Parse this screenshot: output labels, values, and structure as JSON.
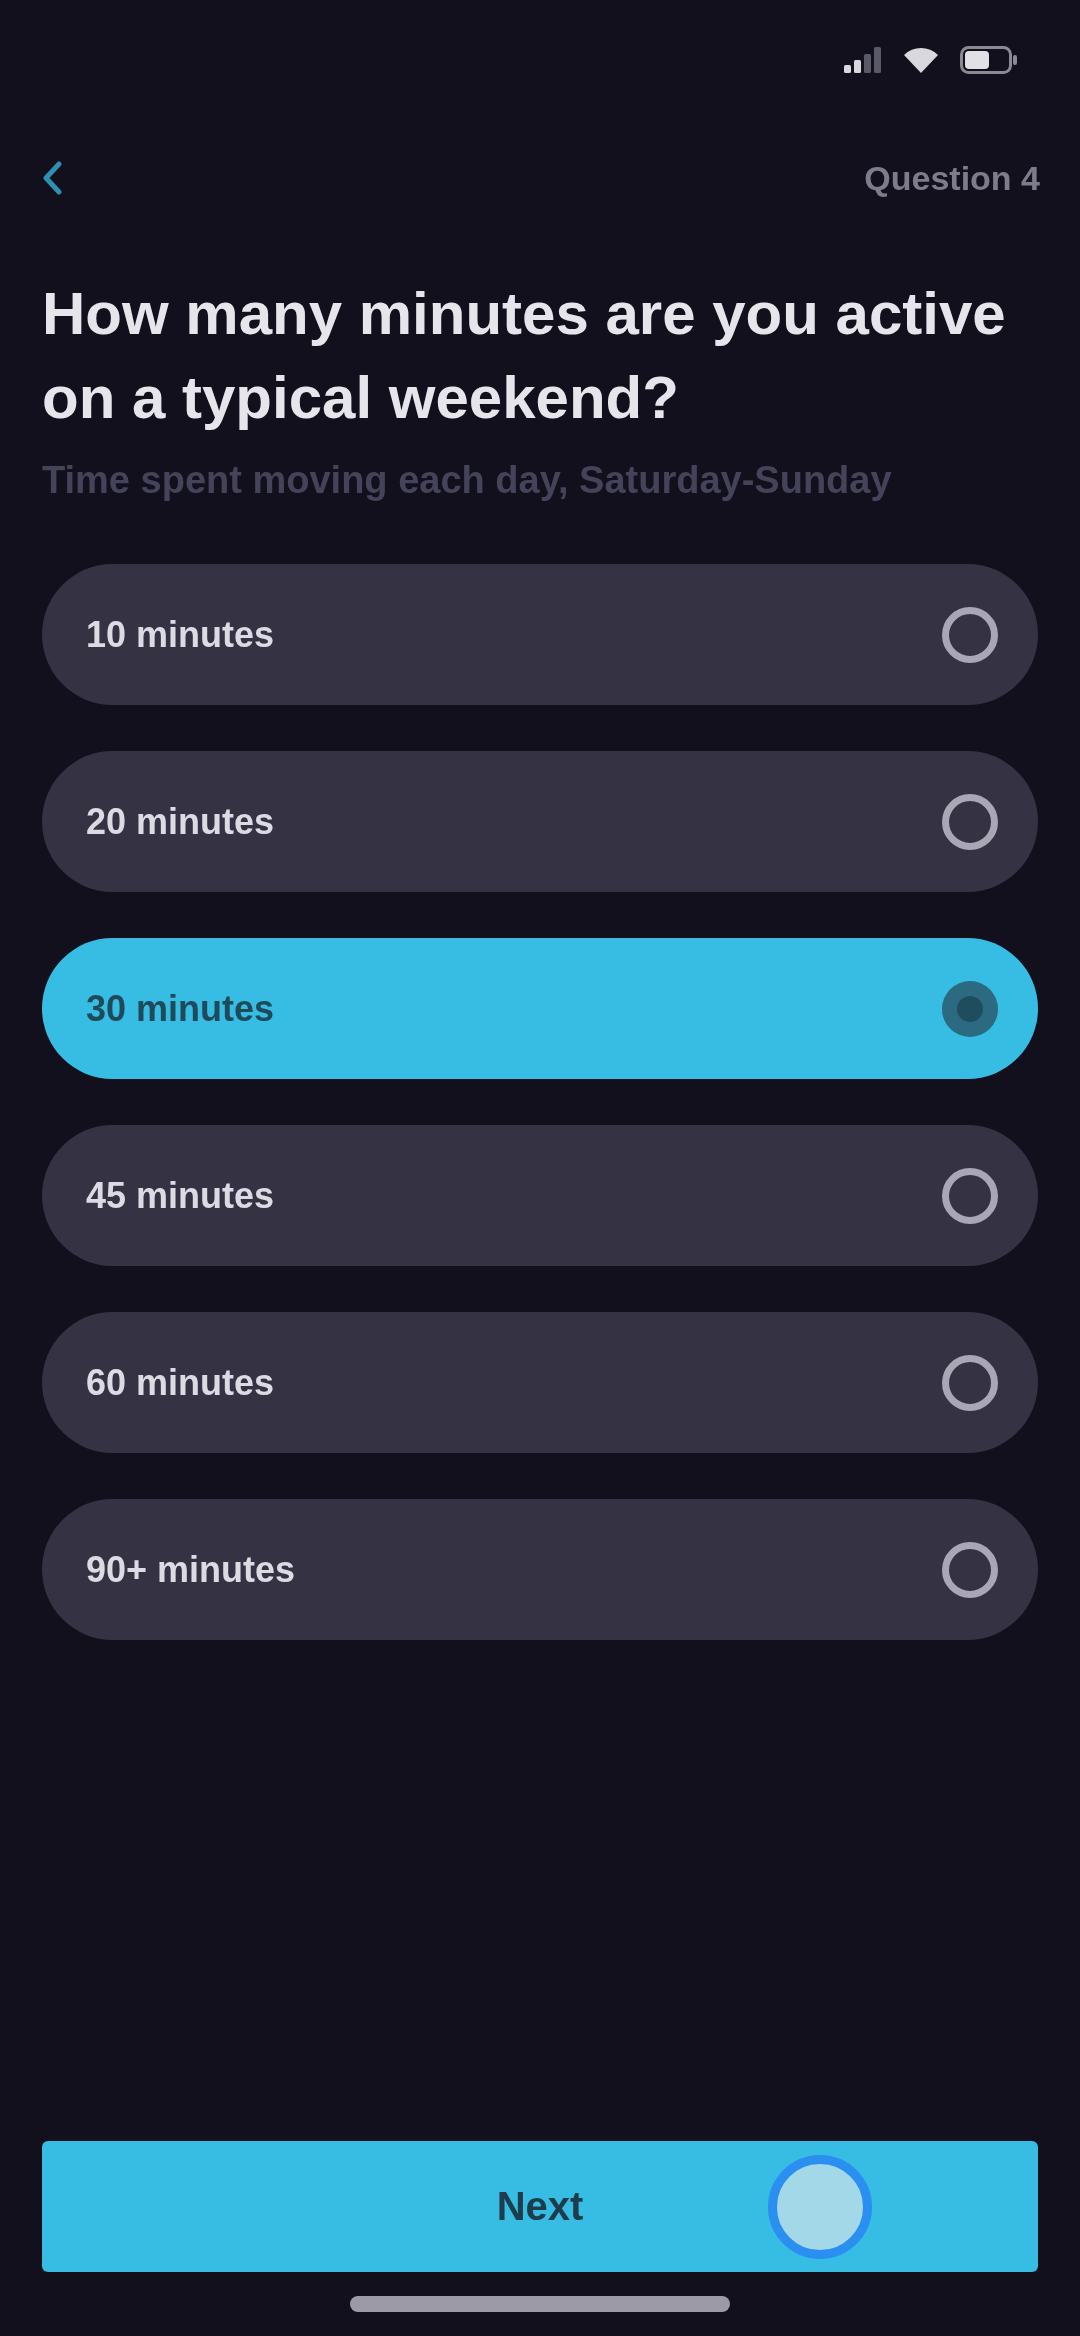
{
  "header": {
    "step": "Question 4"
  },
  "question": {
    "title": "How many minutes are you active on a typical weekend?",
    "subtitle": "Time spent moving each day, Saturday-Sunday"
  },
  "options": [
    {
      "label": "10 minutes",
      "selected": false
    },
    {
      "label": "20 minutes",
      "selected": false
    },
    {
      "label": "30 minutes",
      "selected": true
    },
    {
      "label": "45 minutes",
      "selected": false
    },
    {
      "label": "60 minutes",
      "selected": false
    },
    {
      "label": "90+ minutes",
      "selected": false
    }
  ],
  "next_button": {
    "label": "Next"
  }
}
